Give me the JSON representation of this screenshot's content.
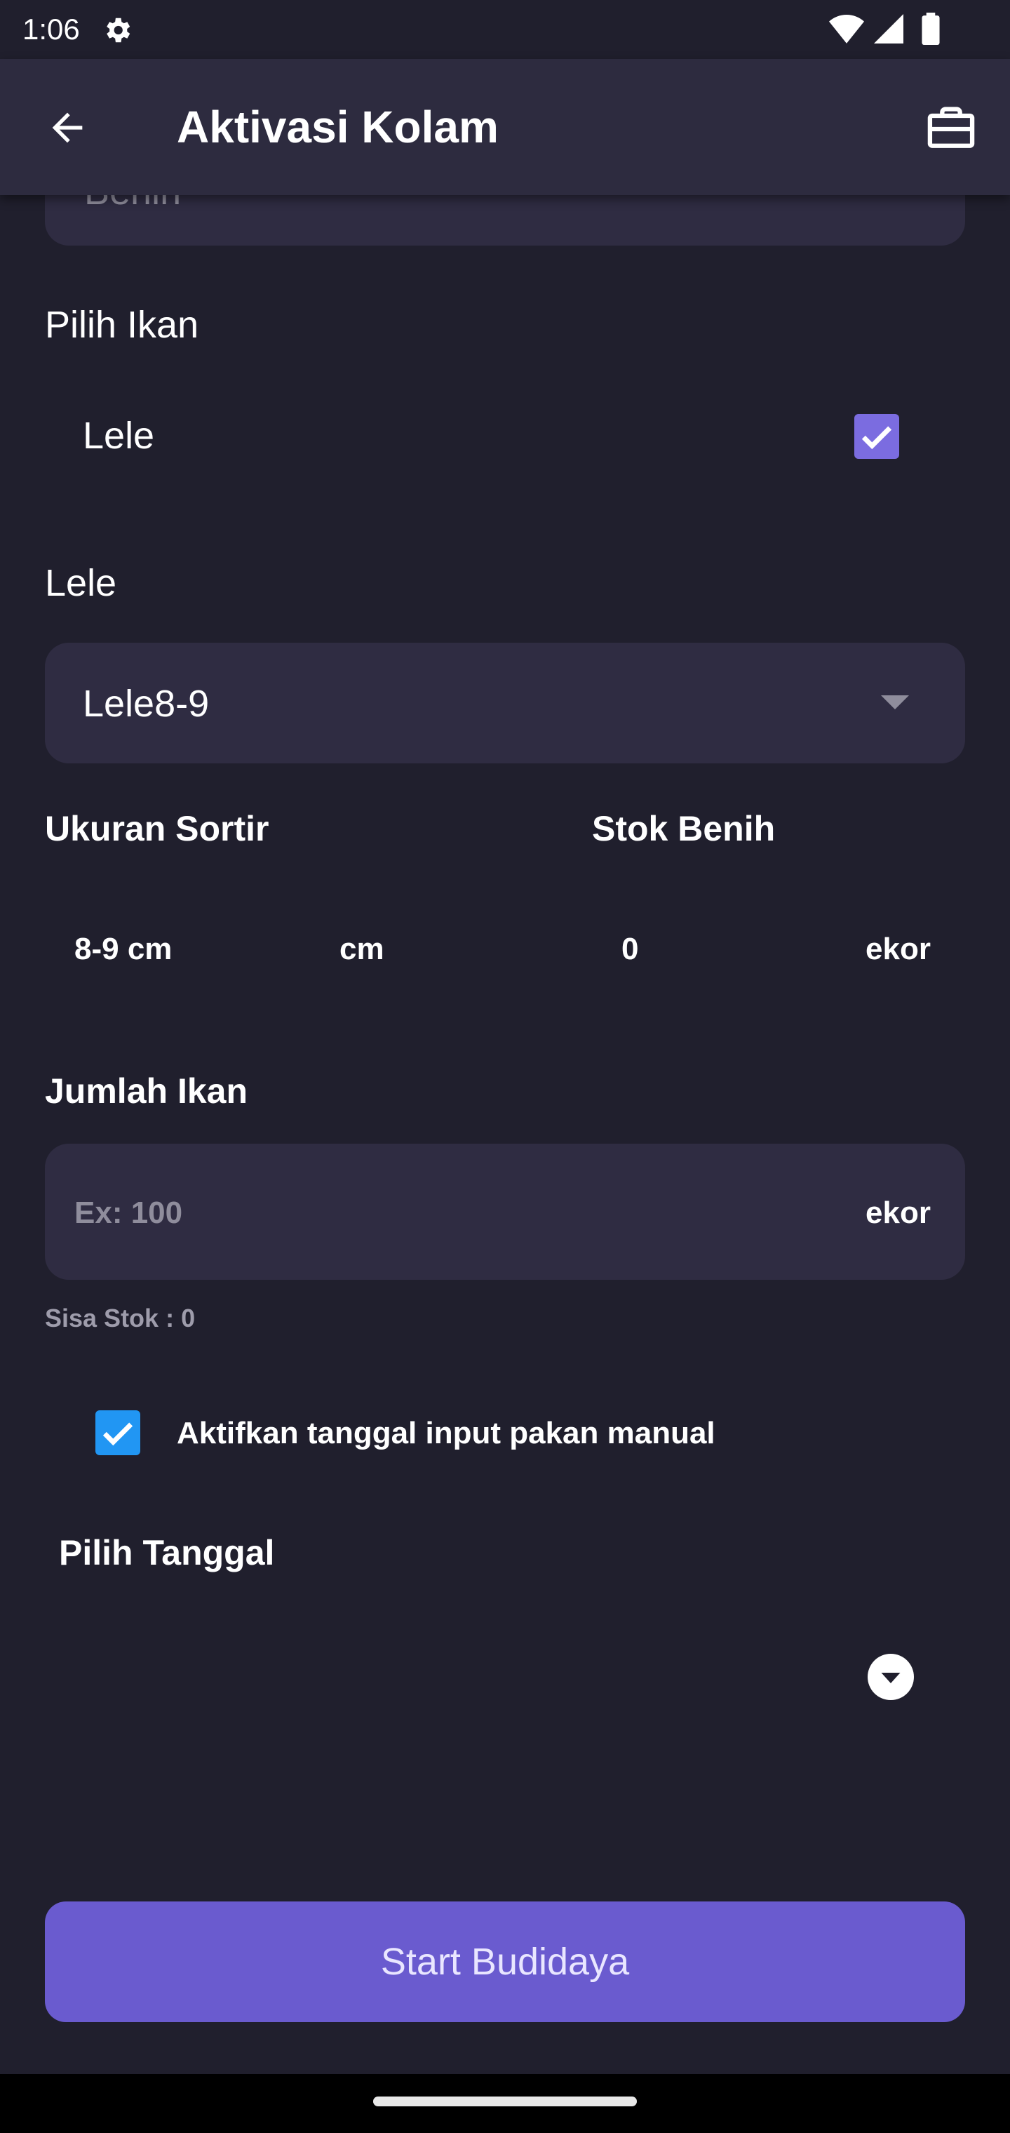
{
  "status_bar": {
    "time": "1:06"
  },
  "app_bar": {
    "title": "Aktivasi Kolam"
  },
  "form": {
    "benih_field_partial": "Benih",
    "pilih_ikan_label": "Pilih Ikan",
    "fish_option": {
      "label": "Lele",
      "checked": true
    },
    "lele_label": "Lele",
    "lele_dropdown_value": "Lele8-9",
    "ukuran_sortir_label": "Ukuran Sortir",
    "stok_benih_label": "Stok Benih",
    "ukuran_value": "8-9 cm",
    "ukuran_unit": "cm",
    "stok_value": "0",
    "stok_unit": "ekor",
    "jumlah_ikan_label": "Jumlah Ikan",
    "jumlah_placeholder": "Ex: 100",
    "jumlah_unit": "ekor",
    "sisa_stok": "Sisa Stok : 0",
    "manual_feed_label": "Aktifkan tanggal input pakan manual",
    "manual_feed_checked": true,
    "pilih_tanggal_label": "Pilih Tanggal"
  },
  "start_button_label": "Start Budidaya",
  "colors": {
    "accent": "#6a5bcf",
    "checkbox": "#7b6ce0",
    "checkbox_blue": "#2196f3",
    "background": "#201f2d",
    "appbar": "#2d2b3f",
    "field": "#2f2c42"
  },
  "icons": [
    "settings-icon",
    "wifi-icon",
    "signal-icon",
    "battery-icon",
    "back-arrow-icon",
    "briefcase-icon",
    "dropdown-arrow-icon",
    "check-icon",
    "dropdown-circle-icon"
  ]
}
